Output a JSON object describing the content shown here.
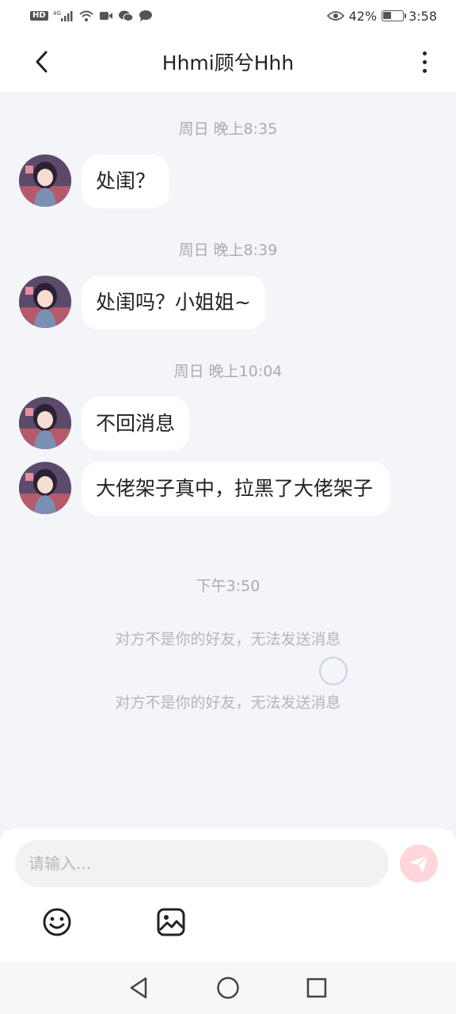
{
  "status_bar": {
    "left_icons": [
      "hd-icon",
      "4g-signal-icon",
      "wifi-icon",
      "video-icon",
      "wechat-icon",
      "message-icon"
    ],
    "battery_percent": "42%",
    "battery_level": 0.42,
    "time": "3:58"
  },
  "header": {
    "title": "Hhmi顾兮Hhh"
  },
  "messages": [
    {
      "time": "周日 晚上8:35",
      "text": "处闺？"
    },
    {
      "time": "周日 晚上8:39",
      "text": "处闺吗？小姐姐~"
    },
    {
      "time": "周日 晚上10:04",
      "text": "不回消息"
    },
    {
      "time": "",
      "text": "大佬架子真中，拉黑了大佬架子"
    }
  ],
  "system": {
    "time": "下午3:50",
    "notice_1": "对方不是你的好友，无法发送消息",
    "notice_2": "对方不是你的好友，无法发送消息"
  },
  "input": {
    "placeholder": "请输入..."
  },
  "colors": {
    "background": "#f4f5f9",
    "bubble": "#ffffff",
    "send_button": "#ffd6d9",
    "system_text": "#b4b6bd"
  }
}
